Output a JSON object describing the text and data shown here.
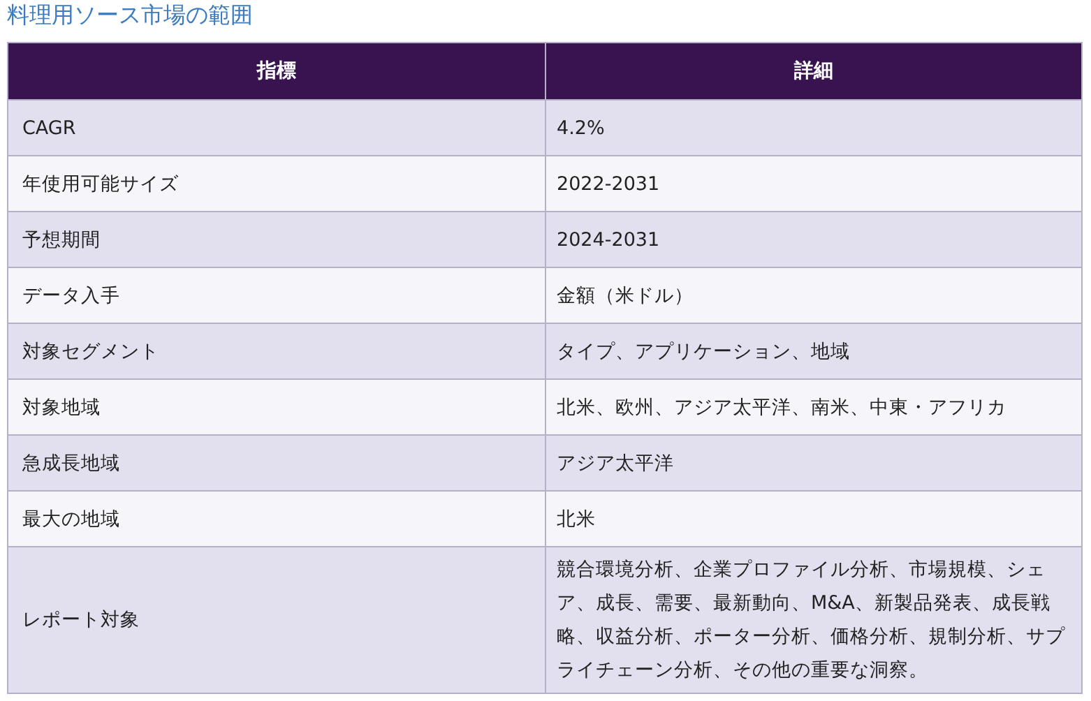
{
  "title": "料理用ソース市場の範囲",
  "table": {
    "columns": [
      "指標",
      "詳細"
    ],
    "rows": [
      [
        "CAGR",
        "4.2%"
      ],
      [
        "年使用可能サイズ",
        "2022-2031"
      ],
      [
        "予想期間",
        "2024-2031"
      ],
      [
        "データ入手",
        "金額（米ドル）"
      ],
      [
        "対象セグメント",
        "タイプ、アプリケーション、地域"
      ],
      [
        "対象地域",
        "北米、欧州、アジア太平洋、南米、中東・アフリカ"
      ],
      [
        "急成長地域",
        "アジア太平洋"
      ],
      [
        "最大の地域",
        "北米"
      ],
      [
        "レポート対象",
        "競合環境分析、企業プロファイル分析、市場規模、シェア、成長、需要、最新動向、M&A、新製品発表、成長戦略、収益分析、ポーター分析、価格分析、規制分析、サプライチェーン分析、その他の重要な洞察。"
      ]
    ]
  }
}
